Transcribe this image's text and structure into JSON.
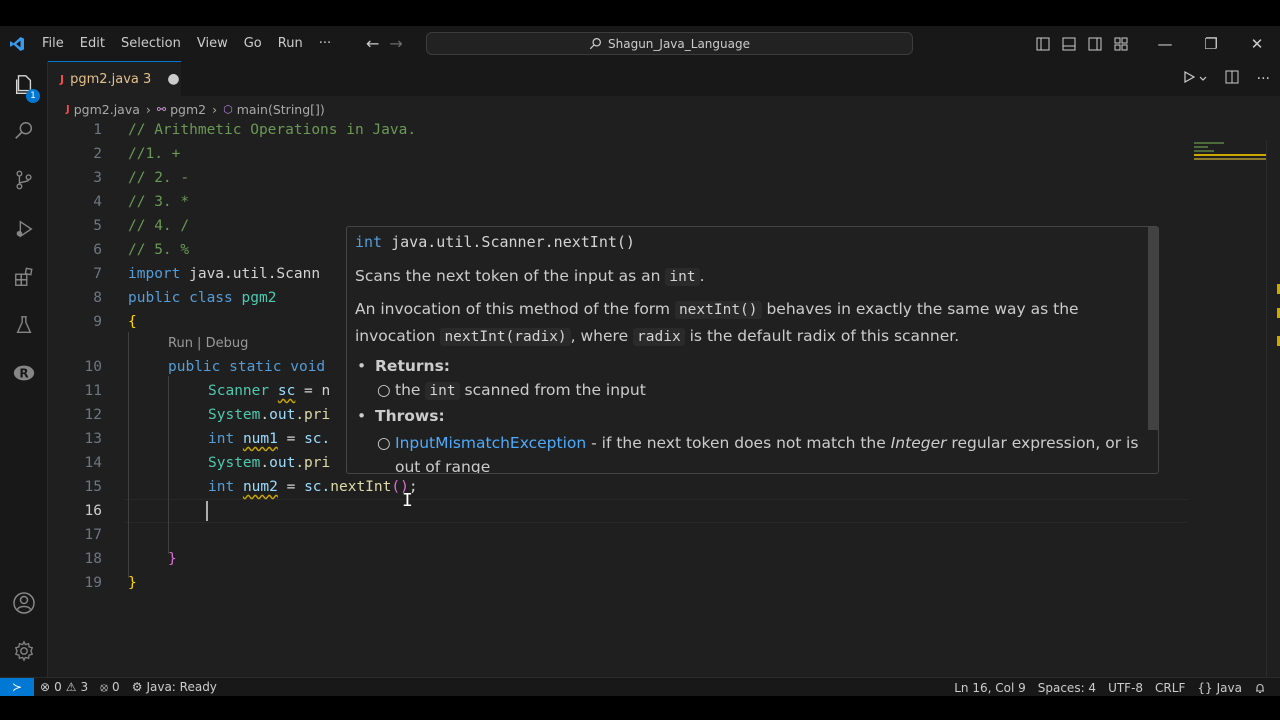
{
  "titlebar": {
    "menu": [
      "File",
      "Edit",
      "Selection",
      "View",
      "Go",
      "Run",
      "···"
    ],
    "back_icon": "←",
    "forward_icon": "→",
    "search_icon": "⚲",
    "search_text": "Shagun_Java_Language",
    "minimize": "—",
    "restore": "❐",
    "close": "✕"
  },
  "activity": {
    "explorer_badge": "1"
  },
  "tab": {
    "icon": "J",
    "label": "pgm2.java 3",
    "dirty": "●"
  },
  "breadcrumb": {
    "file": "pgm2.java",
    "class": "pgm2",
    "method": "main(String[])"
  },
  "code": {
    "lines": [
      {
        "n": "1",
        "text": "// Arithmetic Operations in Java."
      },
      {
        "n": "2",
        "text": "//1. +"
      },
      {
        "n": "3",
        "text": "// 2. -"
      },
      {
        "n": "4",
        "text": "// 3. *"
      },
      {
        "n": "5",
        "text": "// 4. /"
      },
      {
        "n": "6",
        "text": "// 5. %"
      },
      {
        "n": "7"
      },
      {
        "n": "8"
      },
      {
        "n": "9"
      },
      {
        "n": "10"
      },
      {
        "n": "11"
      },
      {
        "n": "12"
      },
      {
        "n": "13"
      },
      {
        "n": "14"
      },
      {
        "n": "15"
      },
      {
        "n": "16"
      },
      {
        "n": "17"
      },
      {
        "n": "18"
      },
      {
        "n": "19"
      }
    ],
    "codelens": "Run | Debug",
    "tokens": {
      "import": "import",
      "import_path": " java.util.Scann",
      "public": "public",
      "class": " class ",
      "class_name": "pgm2",
      "open_brace": "{",
      "static": " static ",
      "void": "void",
      "scanner": "Scanner",
      "sc": "sc",
      "eq_new": " = n",
      "system": "System",
      "dot": ".",
      "out": "out",
      "pri": ".pri",
      "int": "int",
      "num1": "num1",
      "num2": "num2",
      "eq": " = ",
      "sc_dot": "sc.",
      "nextInt": "nextInt",
      "parens": "()",
      "semi": ";",
      "close_brace": "}"
    }
  },
  "hover": {
    "signature_ret": "int",
    "signature_name": " java.util.Scanner.nextInt()",
    "desc_1_pre": "Scans the next token of the input as an ",
    "desc_1_code": "int",
    "desc_1_post": ".",
    "desc_2_pre": "An invocation of this method of the form ",
    "desc_2_code1": "nextInt()",
    "desc_2_mid": " behaves in exactly the same way as the invocation ",
    "desc_2_code2": "nextInt(radix)",
    "desc_2_mid2": ", where ",
    "desc_2_code3": "radix",
    "desc_2_post": " is the default radix of this scanner.",
    "returns_label": "Returns:",
    "returns_pre": "the ",
    "returns_code": "int",
    "returns_post": " scanned from the input",
    "throws_label": "Throws:",
    "throws_link": "InputMismatchException",
    "throws_pre": " - if the next token does not match the ",
    "throws_italic": "Integer",
    "throws_post": " regular expression, or is out of range"
  },
  "statusbar": {
    "remote_icon": "≻",
    "errors": "0",
    "warnings": "3",
    "ports": "0",
    "java_status": "Java: Ready",
    "position": "Ln 16, Col 9",
    "spaces": "Spaces: 4",
    "encoding": "UTF-8",
    "eol": "CRLF",
    "language": "Java",
    "language_icon": "{}",
    "bell_icon": "🔔"
  },
  "colors": {
    "accent": "#0078d4",
    "editor_bg": "#1f1f1f",
    "chrome_bg": "#181818",
    "comment": "#6a9955",
    "keyword": "#569cd6",
    "type": "#4ec9b0",
    "variable": "#9cdcfe",
    "function": "#dcdcaa",
    "warning": "#cca700"
  }
}
